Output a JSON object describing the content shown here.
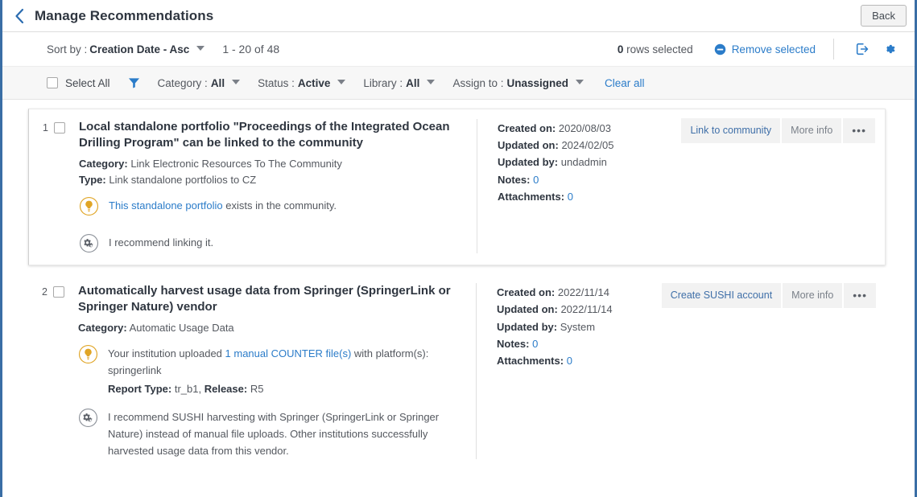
{
  "header": {
    "back_icon": "chevron-left-icon",
    "title": "Manage Recommendations",
    "back_button_label": "Back"
  },
  "toolbar": {
    "sort_label": "Sort by :",
    "sort_value": "Creation Date - Asc",
    "range_info": "1 - 20 of 48",
    "rows_selected_count": "0",
    "rows_selected_label": "rows selected",
    "remove_selected_label": "Remove selected",
    "remove_icon": "minus-circle-icon",
    "export_icon": "export-icon",
    "settings_icon": "gear-icon"
  },
  "filterbar": {
    "select_all_label": "Select All",
    "funnel_icon": "filter-funnel-icon",
    "filters": [
      {
        "label": "Category :",
        "value": "All"
      },
      {
        "label": "Status :",
        "value": "Active"
      },
      {
        "label": "Library :",
        "value": "All"
      },
      {
        "label": "Assign to :",
        "value": "Unassigned"
      }
    ],
    "clear_all_label": "Clear all"
  },
  "recommendations": [
    {
      "number": "1",
      "title": "Local standalone portfolio \"Proceedings of the Integrated Ocean Drilling Program\" can be linked to the community",
      "category_label": "Category:",
      "category_value": "Link Electronic Resources To The Community",
      "type_label": "Type:",
      "type_value": "Link standalone portfolios to CZ",
      "insight_icon": "lightbulb-icon",
      "insight_link_text": "This standalone portfolio",
      "insight_rest_text": " exists in the community.",
      "recommend_icon": "gears-icon",
      "recommend_text": "I recommend linking it.",
      "meta": [
        {
          "label": "Created on:",
          "value": "2020/08/03",
          "is_number": false
        },
        {
          "label": "Updated on:",
          "value": "2024/02/05",
          "is_number": false
        },
        {
          "label": "Updated by:",
          "value": "undadmin",
          "is_number": false
        },
        {
          "label": "Notes:",
          "value": "0",
          "is_number": true
        },
        {
          "label": "Attachments:",
          "value": "0",
          "is_number": true
        }
      ],
      "actions": [
        {
          "label": "Link to community",
          "style": "primary"
        },
        {
          "label": "More info",
          "style": "secondary"
        },
        {
          "label": "•••",
          "style": "dots"
        }
      ]
    },
    {
      "number": "2",
      "title": "Automatically harvest usage data from Springer (SpringerLink or Springer Nature) vendor",
      "category_label": "Category:",
      "category_value": "Automatic Usage Data",
      "insight_icon": "lightbulb-icon",
      "insight_pre_text": "Your institution uploaded ",
      "insight_link_text": "1 manual COUNTER file(s)",
      "insight_post_text": " with platform(s): springerlink",
      "report_type_label": "Report Type:",
      "report_type_value": "tr_b1,",
      "release_label": "Release:",
      "release_value": "R5",
      "recommend_icon": "gears-icon",
      "recommend_text": "I recommend SUSHI harvesting with Springer (SpringerLink or Springer Nature) instead of manual file uploads. Other institutions successfully harvested usage data from this vendor.",
      "meta": [
        {
          "label": "Created on:",
          "value": "2022/11/14",
          "is_number": false
        },
        {
          "label": "Updated on:",
          "value": "2022/11/14",
          "is_number": false
        },
        {
          "label": "Updated by:",
          "value": "System",
          "is_number": false
        },
        {
          "label": "Notes:",
          "value": "0",
          "is_number": true
        },
        {
          "label": "Attachments:",
          "value": "0",
          "is_number": true
        }
      ],
      "actions": [
        {
          "label": "Create SUSHI account",
          "style": "primary"
        },
        {
          "label": "More info",
          "style": "secondary"
        },
        {
          "label": "•••",
          "style": "dots"
        }
      ]
    }
  ],
  "colors": {
    "accent_blue": "#2b7cc9",
    "border_blue": "#3a6ea5",
    "text_dark": "#2f3640",
    "text_gray": "#54585f",
    "bulb_orange": "#e0a526"
  }
}
